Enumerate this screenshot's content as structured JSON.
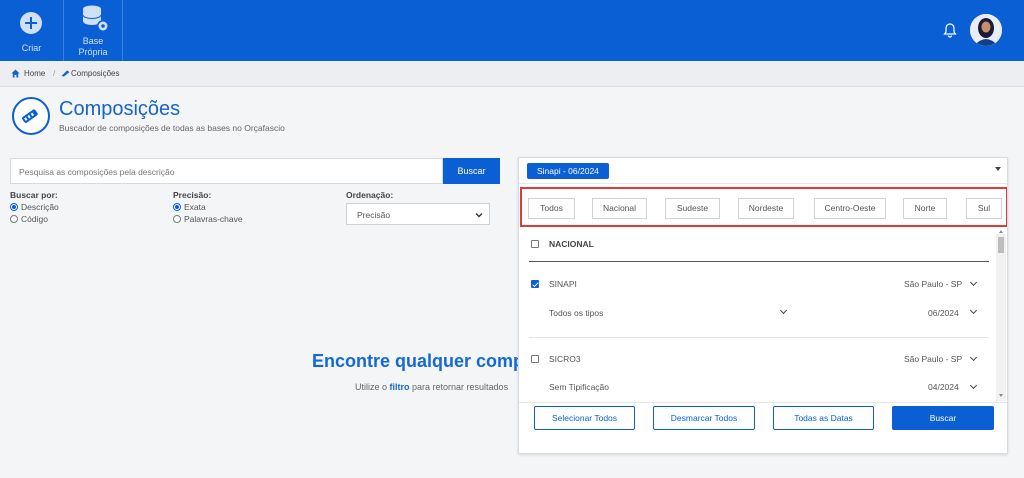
{
  "colors": {
    "brand": "#0a5fd4",
    "highlight": "#e03a3a"
  },
  "topbar": {
    "criar_label": "Criar",
    "base_label_1": "Base",
    "base_label_2": "Própria"
  },
  "breadcrumb": {
    "home": "Home",
    "separator": "/",
    "current": "Composições"
  },
  "page": {
    "title": "Composições",
    "subtitle": "Buscador de composições de todas as bases no Orçafascio"
  },
  "search": {
    "placeholder": "Pesquisa as composições pela descrição",
    "button": "Buscar"
  },
  "filters": {
    "buscar_por": {
      "label": "Buscar por:",
      "options": [
        "Descrição",
        "Código"
      ],
      "selected": "Descrição"
    },
    "precisao": {
      "label": "Precisão:",
      "options": [
        "Exata",
        "Palavras-chave"
      ],
      "selected": "Exata"
    },
    "ordenacao": {
      "label": "Ordenação:",
      "value": "Precisão"
    }
  },
  "empty_state": {
    "title": "Encontre qualquer compos",
    "subtitle_pre": "Utilize o ",
    "subtitle_link": "filtro",
    "subtitle_post": " para retornar resultados"
  },
  "panel": {
    "selected_base": "Sinapi - 06/2024",
    "regions": [
      "Todos",
      "Nacional",
      "Sudeste",
      "Nordeste",
      "Centro-Oeste",
      "Norte",
      "Sul"
    ],
    "group_header": "NACIONAL",
    "bases": [
      {
        "name": "SINAPI",
        "checked": true,
        "location": "São Paulo - SP",
        "type": "Todos os tipos",
        "date": "06/2024"
      },
      {
        "name": "SICRO3",
        "checked": false,
        "location": "São Paulo - SP",
        "type": "Sem Tipificação",
        "date": "04/2024"
      }
    ],
    "footer": {
      "select_all": "Selecionar Todos",
      "deselect_all": "Desmarcar Todos",
      "all_dates": "Todas as Datas",
      "search": "Buscar"
    }
  }
}
